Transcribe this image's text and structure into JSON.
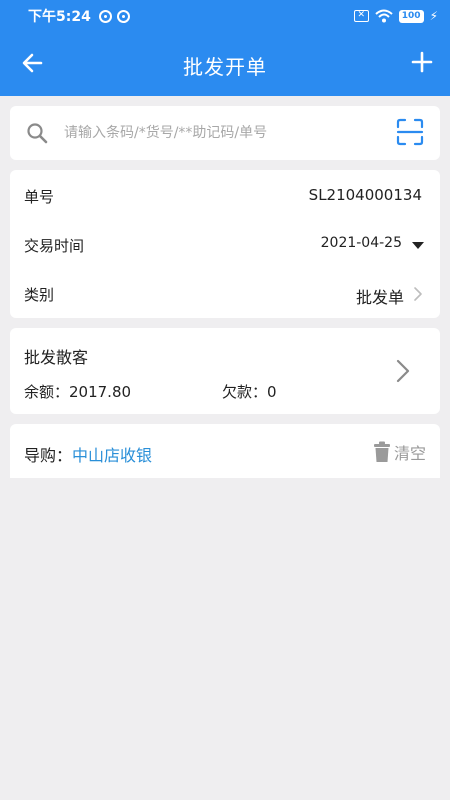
{
  "status": {
    "time": "下午5:24",
    "battery": "100"
  },
  "appbar": {
    "title": "批发开单"
  },
  "search": {
    "placeholder": "请输入条码/*货号/**助记码/单号"
  },
  "order": {
    "number_label": "单号",
    "number_value": "SL2104000134",
    "time_label": "交易时间",
    "time_value": "2021-04-25",
    "type_label": "类别",
    "type_value": "批发单"
  },
  "customer": {
    "name": "批发散客",
    "balance": "余额：2017.80",
    "debt": "欠款：0"
  },
  "guide": {
    "label": "导购：",
    "value": "中山店收银",
    "clear_label": "清空"
  }
}
